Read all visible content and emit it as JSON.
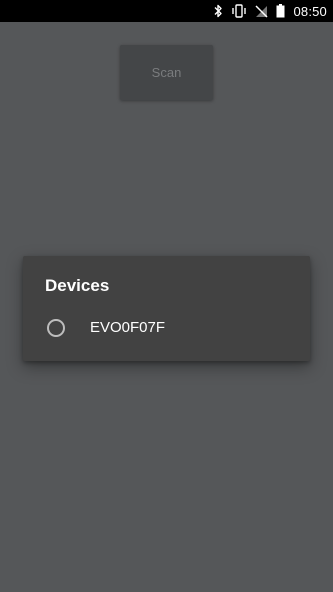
{
  "status_bar": {
    "time": "08:50",
    "icons": [
      "bluetooth-icon",
      "vibrate-icon",
      "no-signal-icon",
      "battery-icon"
    ]
  },
  "scan_button": {
    "label": "Scan"
  },
  "devices_dialog": {
    "title": "Devices",
    "devices": [
      {
        "name": "EVO0F07F",
        "selected": false
      }
    ]
  }
}
